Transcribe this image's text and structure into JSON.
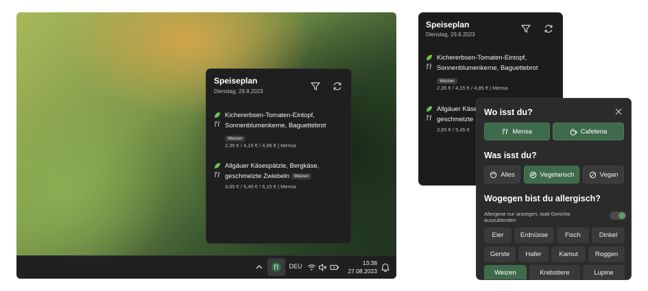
{
  "widget": {
    "title": "Speiseplan",
    "date": "Dienstag, 29.8.2023",
    "meals": [
      {
        "name_line1": "Kichererbsen-Tomaten-Eintopf,",
        "name_line2": "Sonnenblumenkerne, Baguettebrot",
        "allergen": "Weizen",
        "price": "2,35 € / 4,15 € / 4,85 € | Mensa"
      },
      {
        "name_line1": "Allgäuer Käsespätzle, Bergkäse,",
        "name_line2": "geschmelzte Zwiebeln",
        "allergen": "Weizen",
        "price": "3,65 € / 5,45 € / 6,15 € | Mensa"
      }
    ],
    "meals_clipped": [
      {
        "name_line1": "Allgäuer Käse",
        "name_line2": "geschmelzte",
        "price": "3,65 € / 5,45 €"
      }
    ]
  },
  "taskbar": {
    "language": "DEU",
    "time": "13:38",
    "date": "27.08.2023"
  },
  "filter": {
    "where_title": "Wo isst du?",
    "where_options": [
      {
        "label": "Mensa",
        "selected": true
      },
      {
        "label": "Cafeteria",
        "selected": true
      }
    ],
    "what_title": "Was isst du?",
    "what_options": [
      {
        "label": "Alles",
        "selected": false
      },
      {
        "label": "Vegetarisch",
        "selected": true
      },
      {
        "label": "Vegan",
        "selected": false
      }
    ],
    "allergy_title": "Wogegen bist du allergisch?",
    "allergy_note": "Allergene nur anzeigen, statt Gerichte auszublenden",
    "allergy_note_toggle_on": true,
    "allergens": [
      {
        "label": "Eier",
        "selected": false
      },
      {
        "label": "Erdnüsse",
        "selected": false
      },
      {
        "label": "Fisch",
        "selected": false
      },
      {
        "label": "Dinkel",
        "selected": false
      },
      {
        "label": "Gerste",
        "selected": false
      },
      {
        "label": "Hafer",
        "selected": false
      },
      {
        "label": "Kamut",
        "selected": false
      },
      {
        "label": "Roggen",
        "selected": false
      },
      {
        "label": "Weizen",
        "selected": true
      },
      {
        "label": "Krebstiere",
        "selected": false
      },
      {
        "label": "Lupine",
        "selected": false
      }
    ]
  },
  "colors": {
    "accent_green": "#3f6b4c",
    "leaf_green": "#6cc24a",
    "panel_bg": "#1f1f1f",
    "dialog_bg": "#2b2b2b"
  },
  "icons": {
    "filter": "filter-icon",
    "refresh": "refresh-icon",
    "leaf": "leaf-icon",
    "cutlery": "cutlery-icon",
    "close": "close-icon",
    "coffee": "coffee-icon",
    "bowl": "bowl-icon",
    "vegetarian": "vegetarian-icon",
    "vegan": "vegan-icon"
  }
}
